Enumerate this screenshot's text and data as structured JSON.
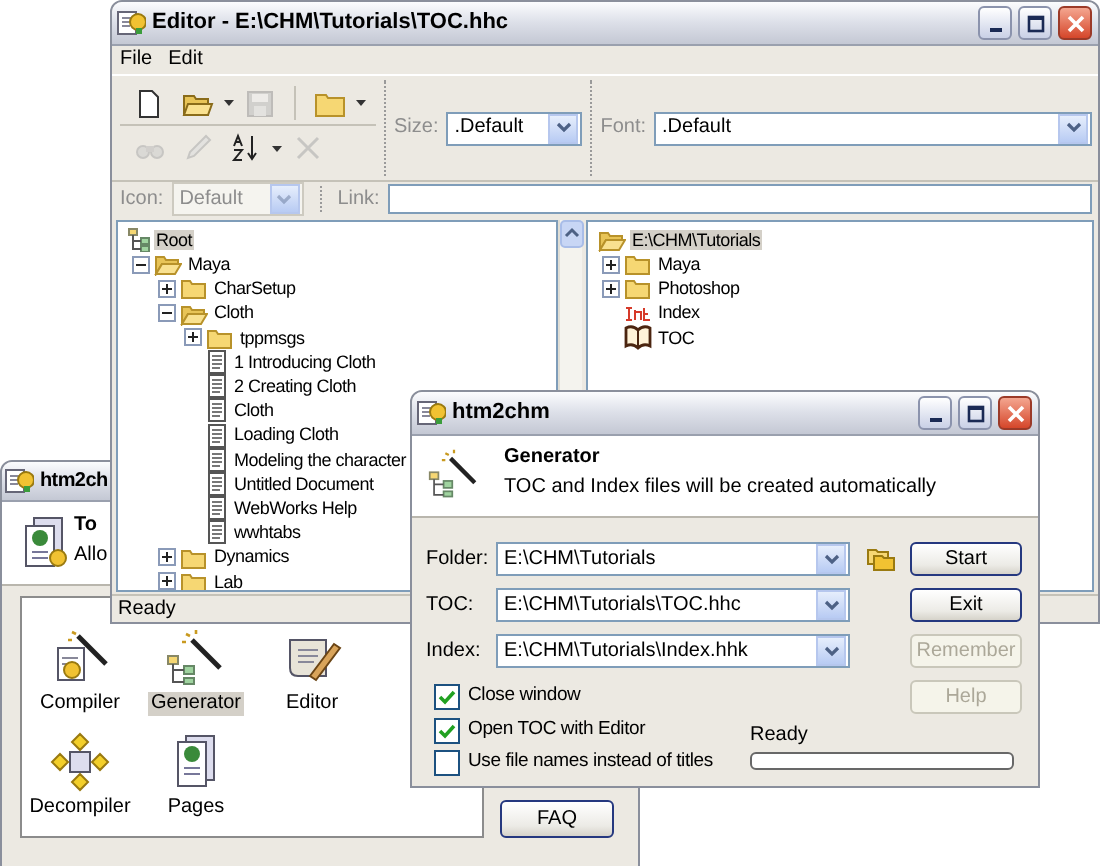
{
  "main_window": {
    "title": "htm2ch",
    "header": {
      "title": "To",
      "subtitle": "Allo"
    },
    "tools": [
      {
        "kind": "compiler",
        "label": "Compiler",
        "selected": false
      },
      {
        "kind": "generator",
        "label": "Generator",
        "selected": true
      },
      {
        "kind": "editor",
        "label": "Editor",
        "selected": false
      },
      {
        "kind": "decompiler",
        "label": "Decompiler",
        "selected": false
      },
      {
        "kind": "pages",
        "label": "Pages",
        "selected": false
      }
    ],
    "buttons": [
      "FAQ"
    ]
  },
  "editor_window": {
    "title": "Editor - E:\\CHM\\Tutorials\\TOC.hhc",
    "menu": [
      "File",
      "Edit"
    ],
    "toolbar_rows": [
      [
        {
          "kind": "new",
          "disabled": false,
          "dropdown": false
        },
        {
          "kind": "open",
          "disabled": false,
          "dropdown": true
        },
        {
          "kind": "save",
          "disabled": true,
          "dropdown": false
        },
        {
          "kind": "separator"
        },
        {
          "kind": "folder",
          "disabled": false,
          "dropdown": true
        }
      ],
      [
        {
          "kind": "find",
          "disabled": true,
          "dropdown": false
        },
        {
          "kind": "edit",
          "disabled": true,
          "dropdown": false
        },
        {
          "kind": "sort",
          "disabled": false,
          "dropdown": true
        },
        {
          "kind": "delete",
          "disabled": true,
          "dropdown": false
        }
      ]
    ],
    "size": {
      "label": "Size:",
      "value": ".Default"
    },
    "font": {
      "label": "Font:",
      "value": ".Default"
    },
    "icon": {
      "label": "Icon:",
      "value": "Default",
      "disabled": true
    },
    "link": {
      "label": "Link:"
    },
    "toc_tree": [
      {
        "label": "Root",
        "kind": "root",
        "selected": true,
        "children": [
          {
            "label": "Maya",
            "kind": "folder",
            "expanded": true,
            "selected": false,
            "children": [
              {
                "label": "CharSetup",
                "kind": "folder",
                "expanded": false,
                "selected": false
              },
              {
                "label": "Cloth",
                "kind": "folder",
                "expanded": true,
                "selected": false,
                "children": [
                  {
                    "label": "tppmsgs",
                    "kind": "folder",
                    "expanded": false,
                    "selected": false
                  },
                  {
                    "label": "1 Introducing Cloth",
                    "kind": "page",
                    "selected": false
                  },
                  {
                    "label": "2 Creating Cloth",
                    "kind": "page",
                    "selected": false
                  },
                  {
                    "label": "Cloth",
                    "kind": "page",
                    "selected": false
                  },
                  {
                    "label": "Loading Cloth",
                    "kind": "page",
                    "selected": false
                  },
                  {
                    "label": "Modeling the character",
                    "kind": "page",
                    "selected": false
                  },
                  {
                    "label": "Untitled Document",
                    "kind": "page",
                    "selected": false
                  },
                  {
                    "label": "WebWorks Help",
                    "kind": "page",
                    "selected": false
                  },
                  {
                    "label": "wwhtabs",
                    "kind": "page",
                    "selected": false
                  }
                ]
              },
              {
                "label": "Dynamics",
                "kind": "folder",
                "expanded": false,
                "selected": false
              },
              {
                "label": "Lab",
                "kind": "folder",
                "expanded": false,
                "selected": false
              }
            ]
          }
        ]
      }
    ],
    "file_tree": [
      {
        "label": "E:\\CHM\\Tutorials",
        "kind": "folder",
        "selected": true,
        "children": [
          {
            "label": "Maya",
            "kind": "folder",
            "expanded": false,
            "selected": false
          },
          {
            "label": "Photoshop",
            "kind": "folder",
            "expanded": false,
            "selected": false
          },
          {
            "label": "Index",
            "kind": "index",
            "selected": false
          },
          {
            "label": "TOC",
            "kind": "toc",
            "selected": false
          }
        ]
      }
    ],
    "status_bar": "Ready"
  },
  "generator_dialog": {
    "title": "htm2chm",
    "header": {
      "title": "Generator",
      "subtitle": "TOC and Index files will be created automatically"
    },
    "fields": [
      {
        "label": "Folder:",
        "value": "E:\\CHM\\Tutorials",
        "browse": true
      },
      {
        "label": "TOC:",
        "value": "E:\\CHM\\Tutorials\\TOC.hhc",
        "browse": false
      },
      {
        "label": "Index:",
        "value": "E:\\CHM\\Tutorials\\Index.hhk",
        "browse": false
      }
    ],
    "buttons": [
      {
        "label": "Start",
        "disabled": false
      },
      {
        "label": "Exit",
        "disabled": false
      },
      {
        "label": "Remember",
        "disabled": true
      },
      {
        "label": "Help",
        "disabled": true
      }
    ],
    "options": [
      {
        "label": "Close window",
        "checked": true
      },
      {
        "label": "Open TOC with Editor",
        "checked": true
      },
      {
        "label": "Use file names instead of titles",
        "checked": false
      }
    ],
    "progress": {
      "label": "Ready",
      "level": 0
    }
  }
}
